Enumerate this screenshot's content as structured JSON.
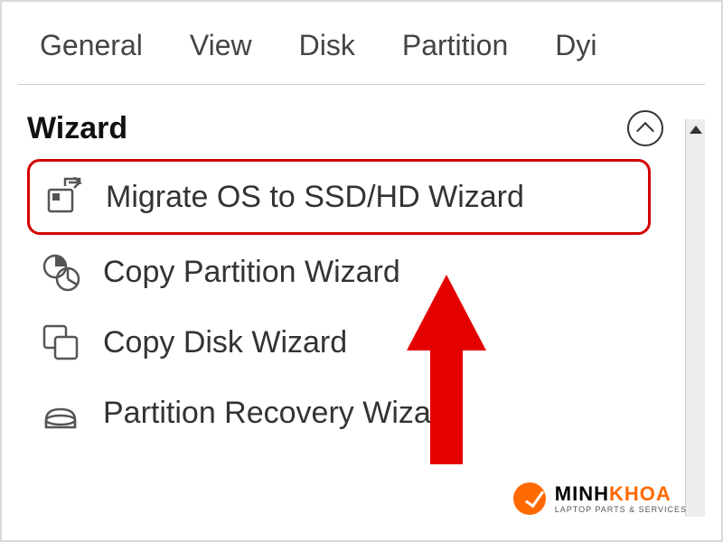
{
  "menubar": {
    "items": [
      "General",
      "View",
      "Disk",
      "Partition",
      "Dyi"
    ]
  },
  "panel": {
    "title": "Wizard",
    "items": [
      {
        "label": "Migrate OS to SSD/HD Wizard",
        "icon": "migrate-os-icon",
        "highlight": true
      },
      {
        "label": "Copy Partition Wizard",
        "icon": "copy-partition-icon",
        "highlight": false
      },
      {
        "label": "Copy Disk Wizard",
        "icon": "copy-disk-icon",
        "highlight": false
      },
      {
        "label": "Partition Recovery Wizard",
        "icon": "partition-recovery-icon",
        "highlight": false
      }
    ]
  },
  "branding": {
    "name_prefix": "MINH",
    "name_suffix": "KHOA",
    "tagline": "LAPTOP PARTS & SERVICES"
  },
  "annotation": {
    "arrow": "red-up-arrow"
  }
}
